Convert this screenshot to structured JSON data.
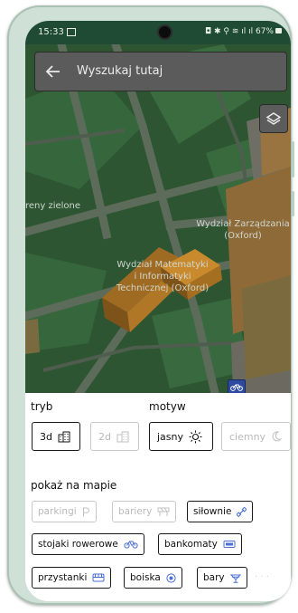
{
  "status": {
    "time": "15:33",
    "battery": "67%"
  },
  "search": {
    "placeholder": "Wyszukaj tutaj"
  },
  "map": {
    "labels": {
      "green_areas": "reny zielone",
      "wz_line1": "Wydział Zarządzania",
      "wz_line2": "(Oxford)",
      "wmi_line1": "Wydział Matematyki",
      "wmi_line2": "i Informatyki",
      "wmi_line3": "Technicznej (Oxford)"
    }
  },
  "sheet": {
    "mode_label": "tryb",
    "theme_label": "motyw",
    "mode_options": [
      {
        "label": "3d",
        "icon": "building-icon",
        "active": true
      },
      {
        "label": "2d",
        "icon": "building-icon",
        "active": false
      }
    ],
    "theme_options": [
      {
        "label": "jasny",
        "icon": "sun-icon",
        "active": true
      },
      {
        "label": "ciemny",
        "icon": "moon-icon",
        "active": false
      }
    ],
    "show_label": "pokaż na mapie",
    "layers": [
      {
        "label": "parkingi",
        "icon": "parking-icon",
        "active": false
      },
      {
        "label": "bariery",
        "icon": "barrier-icon",
        "active": false
      },
      {
        "label": "siłownie",
        "icon": "dumbbell-icon",
        "active": true
      },
      {
        "label": "stojaki rowerowe",
        "icon": "bicycle-icon",
        "active": true
      },
      {
        "label": "bankomaty",
        "icon": "atm-icon",
        "active": true
      },
      {
        "label": "przystanki",
        "icon": "bus-icon",
        "active": true
      },
      {
        "label": "boiska",
        "icon": "ball-icon",
        "active": true
      },
      {
        "label": "bary",
        "icon": "drink-icon",
        "active": true
      }
    ]
  },
  "colors": {
    "accent_blue": "#4a6fd6",
    "building_orange": "#c98a2d",
    "map_dim_green": "#2f5a35"
  }
}
